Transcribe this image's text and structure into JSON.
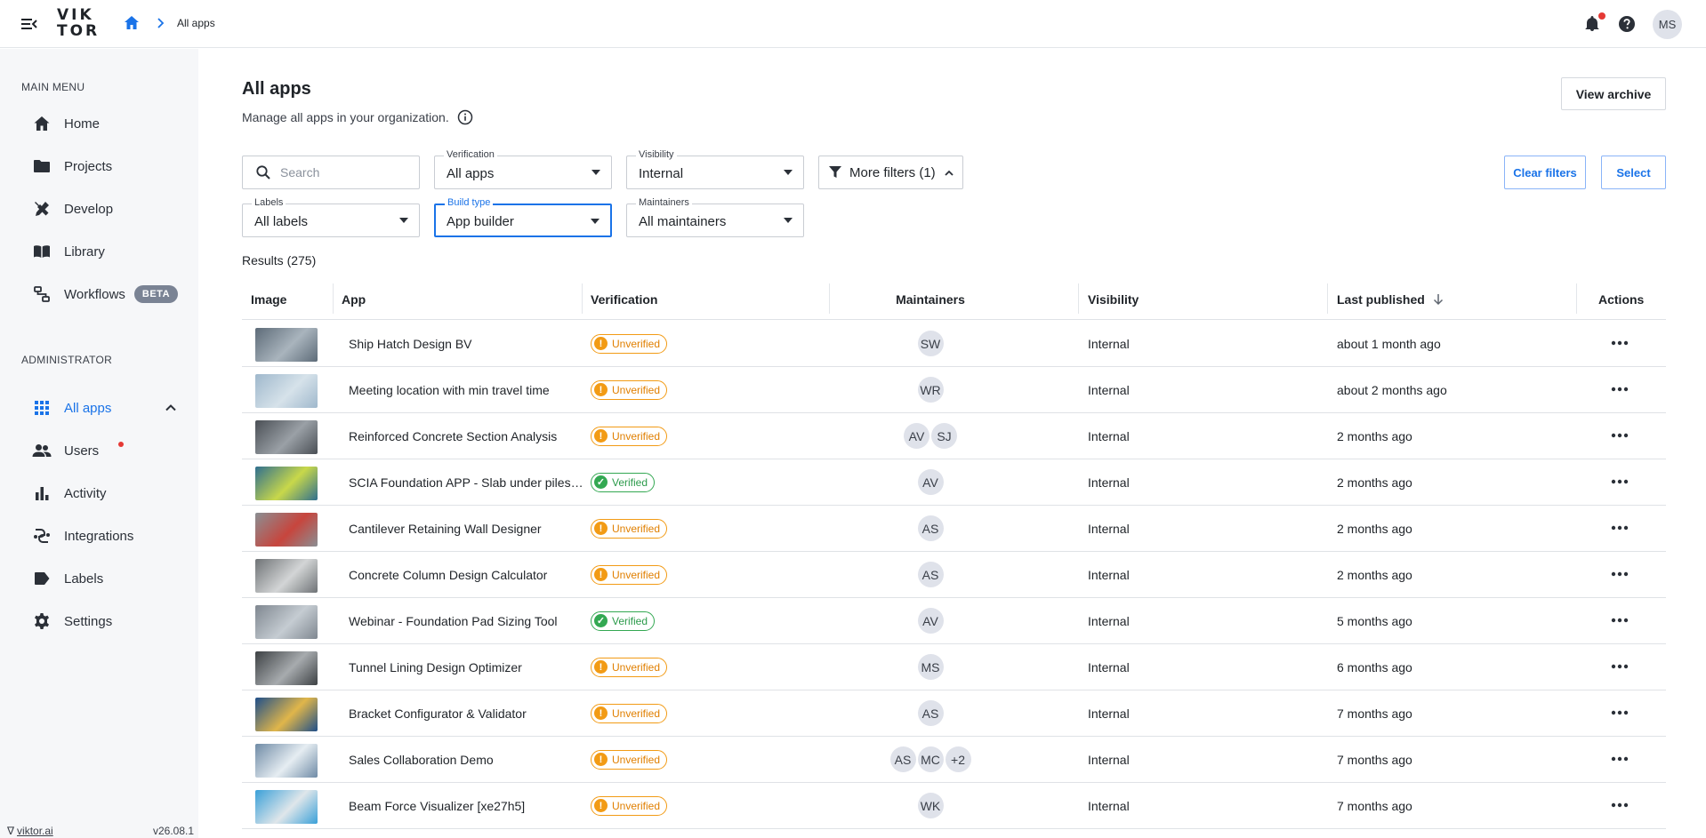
{
  "header": {
    "logo_line1": "VIK",
    "logo_line2": "TOR",
    "breadcrumb_current": "All apps",
    "user_initials": "MS"
  },
  "sidebar": {
    "main_menu_heading": "MAIN MENU",
    "items": [
      {
        "label": "Home",
        "icon": "home-icon"
      },
      {
        "label": "Projects",
        "icon": "folder-icon"
      },
      {
        "label": "Develop",
        "icon": "tools-icon"
      },
      {
        "label": "Library",
        "icon": "book-icon"
      },
      {
        "label": "Workflows",
        "icon": "workflow-icon",
        "badge": "BETA"
      }
    ],
    "admin_heading": "ADMINISTRATOR",
    "admin_items": [
      {
        "label": "All apps",
        "icon": "apps-grid-icon",
        "active": true
      },
      {
        "label": "Users",
        "icon": "users-icon"
      },
      {
        "label": "Activity",
        "icon": "bar-chart-icon"
      },
      {
        "label": "Integrations",
        "icon": "integrations-icon"
      },
      {
        "label": "Labels",
        "icon": "label-icon"
      },
      {
        "label": "Settings",
        "icon": "gear-icon"
      }
    ],
    "footer_link": "viktor.ai",
    "version": "v26.08.1"
  },
  "page": {
    "title": "All apps",
    "subtitle": "Manage all apps in your organization.",
    "view_archive": "View archive",
    "clear_filters": "Clear filters",
    "select": "Select",
    "results": "Results (275)"
  },
  "filters": {
    "search_placeholder": "Search",
    "verification": {
      "label": "Verification",
      "value": "All apps"
    },
    "visibility": {
      "label": "Visibility",
      "value": "Internal"
    },
    "more_filters": "More filters (1)",
    "labels": {
      "label": "Labels",
      "value": "All labels"
    },
    "build_type": {
      "label": "Build type",
      "value": "App builder"
    },
    "maintainers": {
      "label": "Maintainers",
      "value": "All maintainers"
    }
  },
  "table": {
    "columns": [
      "Image",
      "App",
      "Verification",
      "Maintainers",
      "Visibility",
      "Last published",
      "Actions"
    ],
    "rows": [
      {
        "app": "Ship Hatch Design BV",
        "verification": "Unverified",
        "verified": false,
        "maintainers": [
          "SW"
        ],
        "visibility": "Internal",
        "published": "about 1 month ago",
        "thumb": [
          "#5d6b78",
          "#a9b4bd"
        ]
      },
      {
        "app": "Meeting location with min travel time",
        "verification": "Unverified",
        "verified": false,
        "maintainers": [
          "WR"
        ],
        "visibility": "Internal",
        "published": "about 2 months ago",
        "thumb": [
          "#9fb8cc",
          "#d6e2ea"
        ]
      },
      {
        "app": "Reinforced Concrete Section Analysis",
        "verification": "Unverified",
        "verified": false,
        "maintainers": [
          "AV",
          "SJ"
        ],
        "visibility": "Internal",
        "published": "2 months ago",
        "thumb": [
          "#4a4f55",
          "#9aa0a6"
        ]
      },
      {
        "app": "SCIA Foundation APP - Slab under piles…",
        "verification": "Verified",
        "verified": true,
        "maintainers": [
          "AV"
        ],
        "visibility": "Internal",
        "published": "2 months ago",
        "thumb": [
          "#2f6f8f",
          "#c8d84a"
        ]
      },
      {
        "app": "Cantilever Retaining Wall Designer",
        "verification": "Unverified",
        "verified": false,
        "maintainers": [
          "AS"
        ],
        "visibility": "Internal",
        "published": "2 months ago",
        "thumb": [
          "#8a8f93",
          "#c7453d"
        ]
      },
      {
        "app": "Concrete Column Design Calculator",
        "verification": "Unverified",
        "verified": false,
        "maintainers": [
          "AS"
        ],
        "visibility": "Internal",
        "published": "2 months ago",
        "thumb": [
          "#6f7376",
          "#d3d5d6"
        ]
      },
      {
        "app": "Webinar - Foundation Pad Sizing Tool",
        "verification": "Verified",
        "verified": true,
        "maintainers": [
          "AV"
        ],
        "visibility": "Internal",
        "published": "5 months ago",
        "thumb": [
          "#7f8790",
          "#c5ccd2"
        ]
      },
      {
        "app": "Tunnel Lining Design Optimizer",
        "verification": "Unverified",
        "verified": false,
        "maintainers": [
          "MS"
        ],
        "visibility": "Internal",
        "published": "6 months ago",
        "thumb": [
          "#3d4144",
          "#a7abae"
        ]
      },
      {
        "app": "Bracket Configurator & Validator",
        "verification": "Unverified",
        "verified": false,
        "maintainers": [
          "AS"
        ],
        "visibility": "Internal",
        "published": "7 months ago",
        "thumb": [
          "#1f4f8a",
          "#e0b64a"
        ]
      },
      {
        "app": "Sales Collaboration Demo",
        "verification": "Unverified",
        "verified": false,
        "maintainers": [
          "AS",
          "MC",
          "+2"
        ],
        "visibility": "Internal",
        "published": "7 months ago",
        "thumb": [
          "#6f8ba6",
          "#e6edf2"
        ]
      },
      {
        "app": "Beam Force Visualizer [xe27h5]",
        "verification": "Unverified",
        "verified": false,
        "maintainers": [
          "WK"
        ],
        "visibility": "Internal",
        "published": "7 months ago",
        "thumb": [
          "#3aa0d8",
          "#dfe6ea"
        ]
      }
    ]
  },
  "colors": {
    "accent": "#1a73e8",
    "unverified": "#f29b15",
    "verified": "#33a852",
    "sidebar_bg": "#f6f7f9"
  }
}
